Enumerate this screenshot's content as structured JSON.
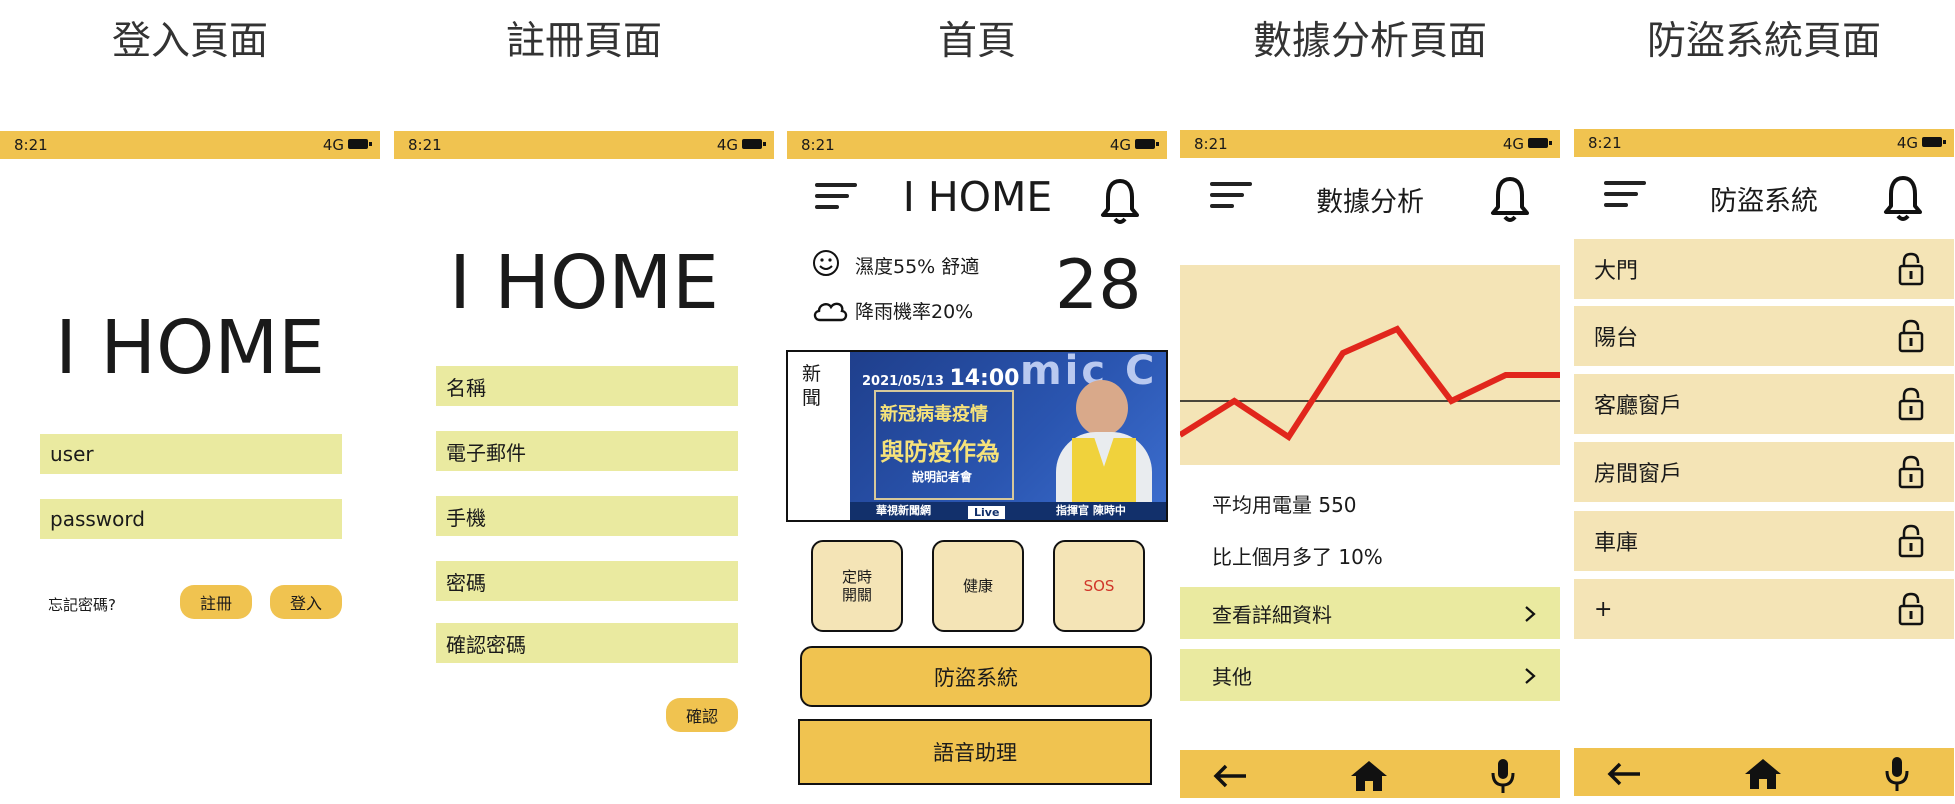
{
  "titles": [
    "登入頁面",
    "註冊頁面",
    "首頁",
    "數據分析頁面",
    "防盜系統頁面"
  ],
  "status": {
    "time": "8:21",
    "network": "4G"
  },
  "colors": {
    "accent": "#f0c350",
    "field": "#eaeaa0",
    "panel": "#f4e4b6",
    "line": "#e1261c"
  },
  "login": {
    "logo": "I HOME",
    "user_value": "user",
    "password_value": "password",
    "forgot": "忘記密碼?",
    "register": "註冊",
    "login": "登入"
  },
  "register": {
    "logo": "I HOME",
    "fields": [
      "名稱",
      "電子郵件",
      "手機",
      "密碼",
      "確認密碼"
    ],
    "confirm": "確認"
  },
  "home": {
    "title": "I HOME",
    "humidity": "濕度55% 舒適",
    "rain": "降雨機率20%",
    "temperature": "28",
    "news_label": "新聞",
    "news": {
      "date": "2021/05/13",
      "time": "14:00",
      "headline_1": "新冠病毒疫情",
      "headline_2": "與防疫作為",
      "sub": "說明記者會",
      "channel": "華視新聞網",
      "live": "Live",
      "speaker": "指揮官 陳時中",
      "bg_text": "mic C"
    },
    "buttons": [
      "定時開關",
      "健康",
      "SOS"
    ],
    "security": "防盜系統",
    "voice": "語音助理"
  },
  "analysis": {
    "title": "數據分析",
    "avg": "平均用電量 550",
    "compare": "比上個月多了 10%",
    "details": "查看詳細資料",
    "other": "其他"
  },
  "chart_data": {
    "type": "line",
    "x": [
      1,
      2,
      3,
      4,
      5,
      6,
      7,
      8
    ],
    "series": [
      {
        "values": [
          0.15,
          0.32,
          0.14,
          0.56,
          0.68,
          0.32,
          0.45,
          0.45
        ]
      }
    ],
    "reference_line": 0.32,
    "ylim": [
      0,
      1
    ],
    "xlabel": "",
    "ylabel": "",
    "line_color": "#e1261c"
  },
  "security": {
    "title": "防盜系統",
    "items": [
      "大門",
      "陽台",
      "客廳窗戶",
      "房間窗戶",
      "車庫",
      "+"
    ]
  },
  "icons": [
    "menu-icon",
    "bell-icon",
    "smile-icon",
    "cloud-icon",
    "lock-icon",
    "chevron-right-icon",
    "back-arrow-icon",
    "home-icon",
    "mic-icon"
  ]
}
